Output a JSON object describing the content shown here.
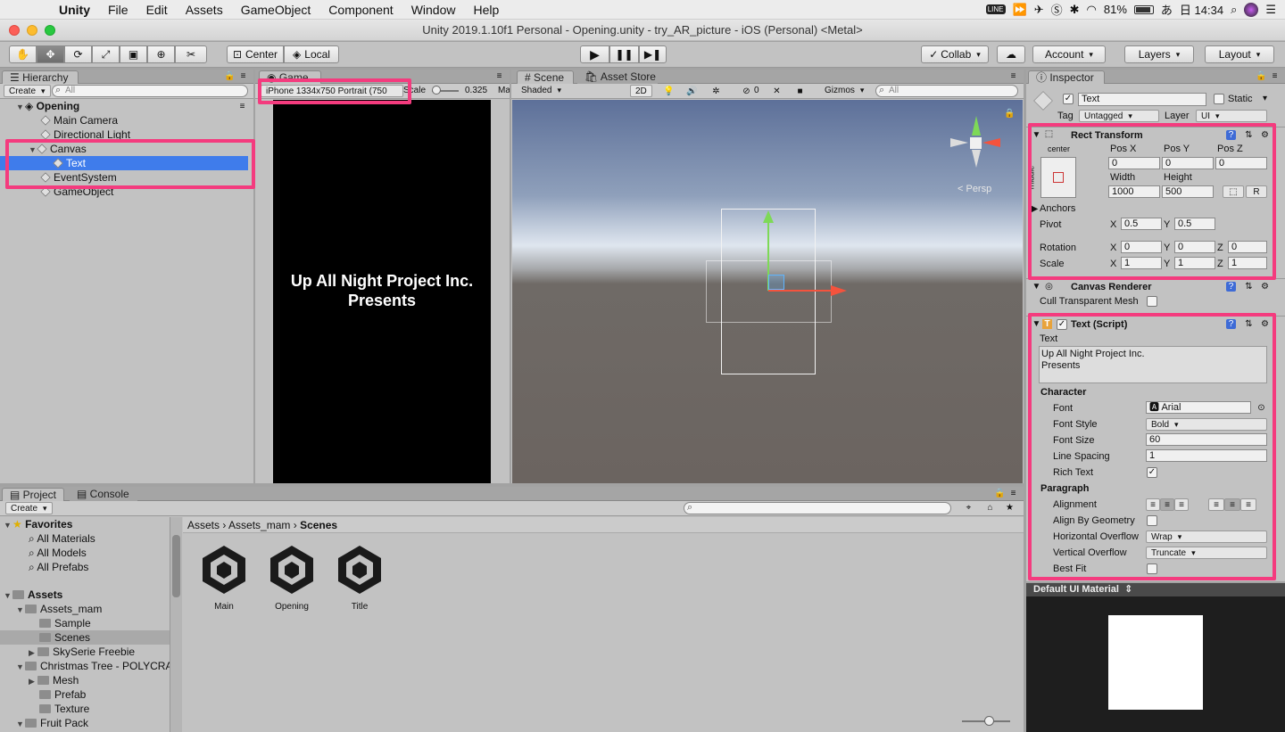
{
  "menubar": {
    "app": "Unity",
    "items": [
      "File",
      "Edit",
      "Assets",
      "GameObject",
      "Component",
      "Window",
      "Help"
    ],
    "battery": "81%",
    "ime": "あ",
    "clock": "日 14:34"
  },
  "window": {
    "title": "Unity 2019.1.10f1 Personal - Opening.unity - try_AR_picture - iOS (Personal) <Metal>"
  },
  "toolbar": {
    "center": "Center",
    "local": "Local",
    "collab": "Collab",
    "account": "Account",
    "layers": "Layers",
    "layout": "Layout"
  },
  "hierarchy": {
    "tab": "Hierarchy",
    "create": "Create",
    "search": "All",
    "scene": "Opening",
    "items": [
      "Main Camera",
      "Directional Light",
      "Canvas",
      "Text",
      "EventSystem",
      "GameObject"
    ]
  },
  "game": {
    "tab": "Game",
    "resolution": "iPhone 1334x750 Portrait (750",
    "scale_label": "Scale",
    "scale": "0.325",
    "ma": "Ma",
    "line1": "Up All Night Project Inc.",
    "line2": "Presents"
  },
  "scene": {
    "tab": "Scene",
    "store_tab": "Asset Store",
    "shading": "Shaded",
    "mode2d": "2D",
    "gizmos": "Gizmos",
    "search": "All",
    "persp": "< Persp",
    "count": "0"
  },
  "inspector": {
    "tab": "Inspector",
    "name": "Text",
    "static": "Static",
    "tag_label": "Tag",
    "tag": "Untagged",
    "layer_label": "Layer",
    "layer": "UI",
    "rect": {
      "title": "Rect Transform",
      "center": "center",
      "middle": "middle",
      "posx_l": "Pos X",
      "posy_l": "Pos Y",
      "posz_l": "Pos Z",
      "posx": "0",
      "posy": "0",
      "posz": "0",
      "width_l": "Width",
      "height_l": "Height",
      "width": "1000",
      "height": "500",
      "anchors": "Anchors",
      "pivot": "Pivot",
      "pivot_x": "0.5",
      "pivot_y": "0.5",
      "rotation": "Rotation",
      "rot_x": "0",
      "rot_y": "0",
      "rot_z": "0",
      "scale": "Scale",
      "sc_x": "1",
      "sc_y": "1",
      "sc_z": "1",
      "X": "X",
      "Y": "Y",
      "Z": "Z",
      "R": "R"
    },
    "canvas_renderer": {
      "title": "Canvas Renderer",
      "cull": "Cull Transparent Mesh"
    },
    "text": {
      "title": "Text (Script)",
      "text_label": "Text",
      "text_line1": "Up All Night Project Inc.",
      "text_line2": "Presents",
      "character": "Character",
      "font_l": "Font",
      "font": "Arial",
      "font_style_l": "Font Style",
      "font_style": "Bold",
      "font_size_l": "Font Size",
      "font_size": "60",
      "line_spacing_l": "Line Spacing",
      "line_spacing": "1",
      "rich_text_l": "Rich Text",
      "paragraph": "Paragraph",
      "alignment_l": "Alignment",
      "align_geom_l": "Align By Geometry",
      "hoverflow_l": "Horizontal Overflow",
      "hoverflow": "Wrap",
      "voverflow_l": "Vertical Overflow",
      "voverflow": "Truncate",
      "best_fit_l": "Best Fit"
    },
    "material": "Default UI Material"
  },
  "project": {
    "tab": "Project",
    "console_tab": "Console",
    "create": "Create",
    "favorites": "Favorites",
    "fav_items": [
      "All Materials",
      "All Models",
      "All Prefabs"
    ],
    "assets": "Assets",
    "tree": [
      "Assets_mam",
      "Sample",
      "Scenes",
      "SkySerie Freebie",
      "Christmas Tree - POLYCRA",
      "Mesh",
      "Prefab",
      "Texture",
      "Fruit Pack"
    ],
    "breadcrumb": [
      "Assets",
      "Assets_mam",
      "Scenes"
    ],
    "files": [
      "Main",
      "Opening",
      "Title"
    ]
  }
}
